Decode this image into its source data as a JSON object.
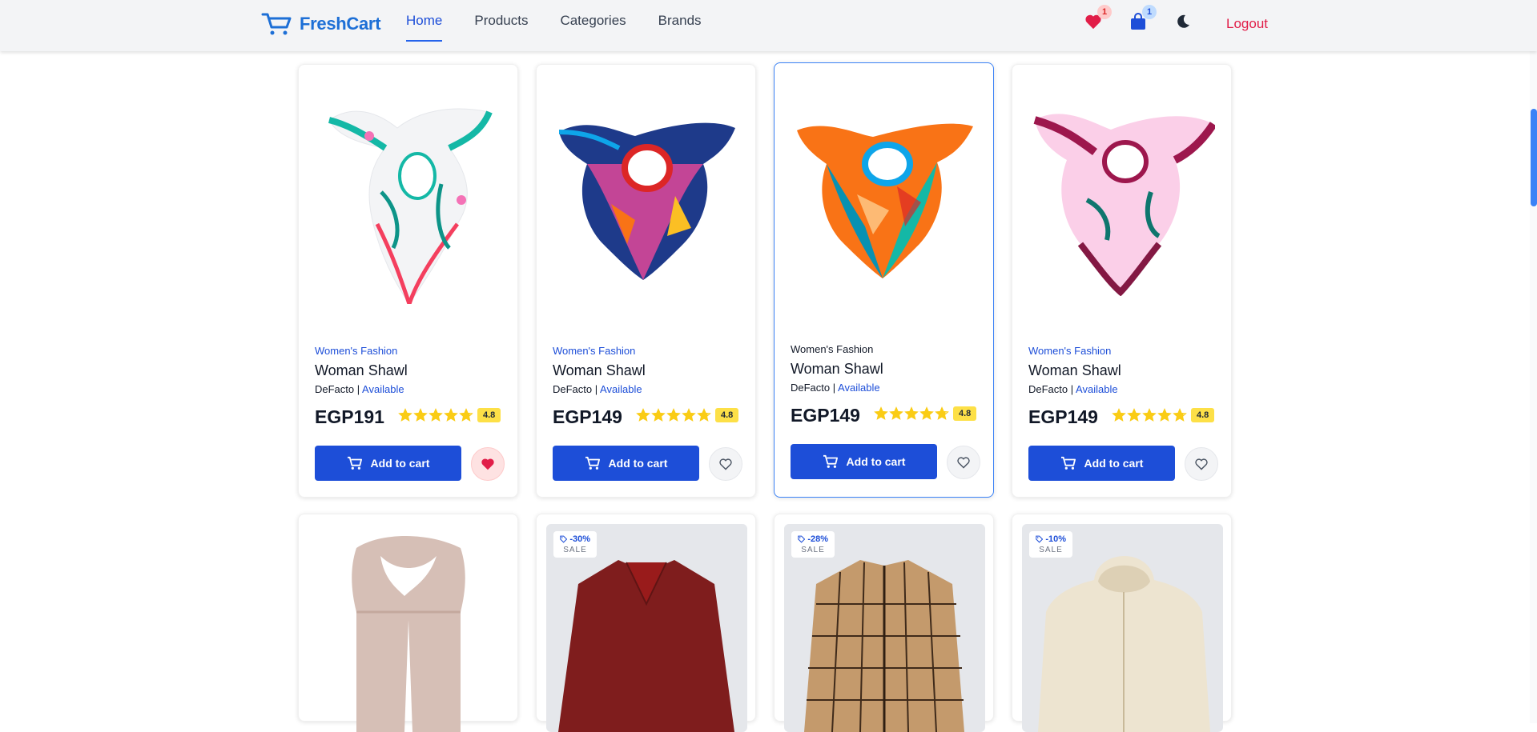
{
  "nav": {
    "logo_text": "FreshCart",
    "links": [
      "Home",
      "Products",
      "Categories",
      "Brands"
    ],
    "wishlist_count": "1",
    "cart_count": "1",
    "logout_label": "Logout"
  },
  "products": [
    {
      "category": "Women's Fashion",
      "title": "Woman Shawl",
      "brand": "DeFacto",
      "availability": "Available",
      "price": "EGP191",
      "rating": "4.8",
      "rating_value": 4.8,
      "add_label": "Add to cart",
      "wishlisted": true
    },
    {
      "category": "Women's Fashion",
      "title": "Woman Shawl",
      "brand": "DeFacto",
      "availability": "Available",
      "price": "EGP149",
      "rating": "4.8",
      "rating_value": 4.8,
      "add_label": "Add to cart",
      "wishlisted": false
    },
    {
      "category": "Women's Fashion",
      "title": "Woman Shawl",
      "brand": "DeFacto",
      "availability": "Available",
      "price": "EGP149",
      "rating": "4.8",
      "rating_value": 4.8,
      "add_label": "Add to cart",
      "wishlisted": false
    },
    {
      "category": "Women's Fashion",
      "title": "Woman Shawl",
      "brand": "DeFacto",
      "availability": "Available",
      "price": "EGP149",
      "rating": "4.8",
      "rating_value": 4.8,
      "add_label": "Add to cart",
      "wishlisted": false
    }
  ],
  "sale_products": [
    {
      "discount": "",
      "sale_label": ""
    },
    {
      "discount": "-30%",
      "sale_label": "SALE"
    },
    {
      "discount": "-28%",
      "sale_label": "SALE"
    },
    {
      "discount": "-10%",
      "sale_label": "SALE"
    }
  ],
  "separator": "|",
  "colors": {
    "primary": "#1d4ed8",
    "logo": "#1d6fd6",
    "logout": "#e11d48",
    "star": "#facc15",
    "rating_badge": "#fde047"
  }
}
